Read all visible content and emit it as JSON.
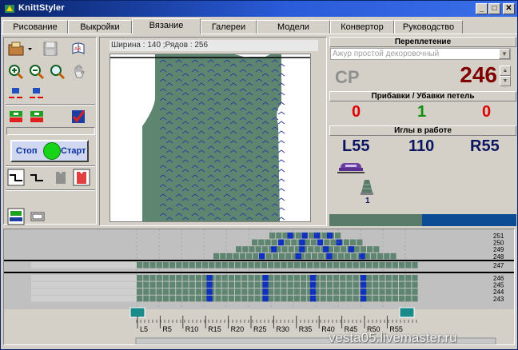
{
  "window": {
    "title": "KnittStyler",
    "controls": {
      "minimize": "_",
      "maximize": "□",
      "close": "✕"
    }
  },
  "tabs": [
    {
      "label": "Рисование",
      "active": false
    },
    {
      "label": "Выкройки",
      "active": false
    },
    {
      "label": "Вязание",
      "active": true
    },
    {
      "label": "Галереи",
      "active": false
    },
    {
      "label": "Модели",
      "active": false
    },
    {
      "label": "Конвертор",
      "active": false
    },
    {
      "label": "Руководство",
      "active": false
    }
  ],
  "toolbar": {
    "stop_label": "Стоп",
    "start_label": "Старт",
    "icons": [
      "open-file-icon",
      "save-icon",
      "print-preview-icon",
      "zoom-in-icon",
      "zoom-out-icon",
      "zoom-fit-icon",
      "hand-pan-icon",
      "shift-left-right-icon",
      "shift-right-left-icon",
      "carriage-left-icon",
      "carriage-right-icon",
      "check-flag-icon",
      "step-left-icon",
      "step-right-icon",
      "vest-icon",
      "vest-red-icon",
      "machine-icon",
      "counter-icon"
    ]
  },
  "preview": {
    "width_label": "Ширина : 140 ;Рядов : 256",
    "fabric_color": "#5e8570",
    "pattern_color": "#2a3fa0"
  },
  "stitch": {
    "section_title": "Переплетение",
    "selected": "Ажур простой декоровочный",
    "code": "CP",
    "row": "246",
    "spin_up": "▲",
    "spin_down": "▼"
  },
  "increases": {
    "section_title": "Прибавки / Убавки петель",
    "left": "0",
    "center": "1",
    "right": "0"
  },
  "needles": {
    "section_title": "Иглы в работе",
    "left": "L55",
    "count": "110",
    "right": "R55",
    "cone_count": "1"
  },
  "grid": {
    "row_labels": [
      "251",
      "250",
      "249",
      "248",
      "247",
      "246",
      "245",
      "244",
      "243"
    ],
    "ruler_labels": [
      "L5",
      "R5",
      "R10",
      "R15",
      "R20",
      "R25",
      "R30",
      "R35",
      "R40",
      "R45",
      "R50",
      "R55"
    ],
    "colors": {
      "fabric": "#5e8570",
      "empty": "#a8a8a8",
      "accent": "#1030c0"
    }
  },
  "watermark": "vesta05.livemaster.ru"
}
